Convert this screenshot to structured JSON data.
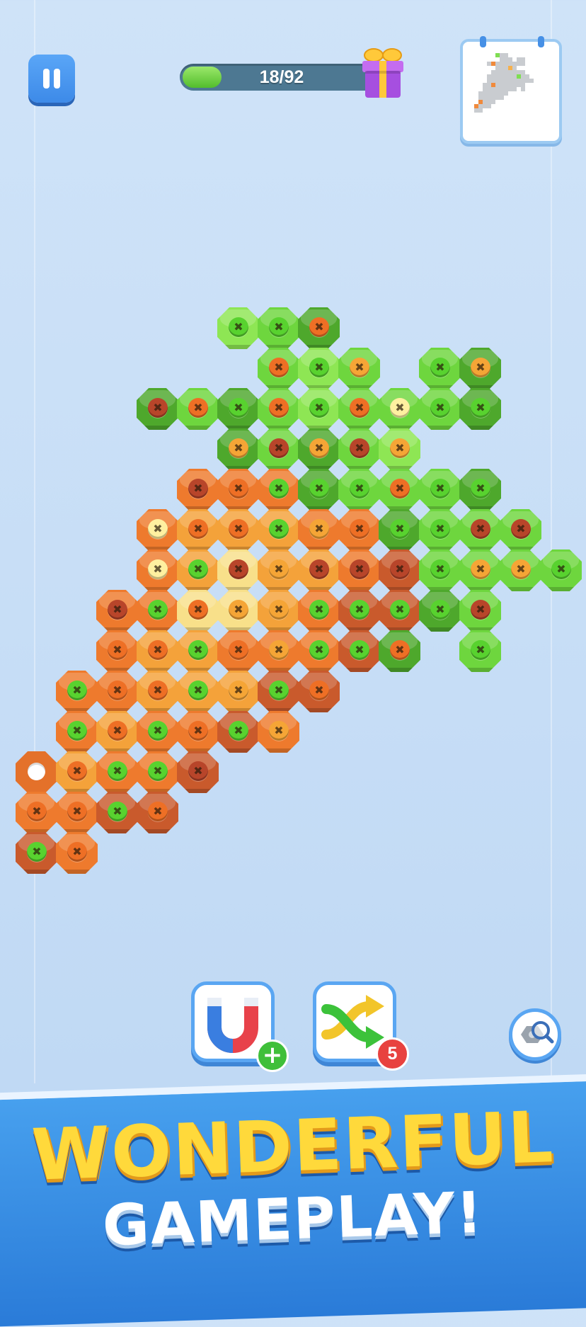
{
  "hud": {
    "progress_text": "18/92",
    "progress_fraction": 0.196,
    "pause_icon": "pause-icon",
    "reward_icon": "gift-box-icon",
    "preview_icon": "picture-preview-icon"
  },
  "colors": {
    "hole_palette": {
      "G": "#6ed63e",
      "L": "#8ee654",
      "D": "#4ea82c",
      "O": "#ee7a2d",
      "A": "#f4a23a",
      "R": "#c95a2c",
      "Y": "#f8e08a"
    },
    "screw_palette": {
      "g": "#58d22f",
      "o": "#ee6f25",
      "a": "#f5a536",
      "r": "#b8452a",
      "y": "#fff0a0"
    }
  },
  "board": {
    "cols": [
      0,
      1,
      2,
      3,
      4,
      5,
      6,
      7,
      8,
      9,
      10,
      11,
      12,
      13
    ],
    "rows": [
      [
        "",
        "",
        "",
        "",
        "",
        "L",
        "G",
        "D",
        "",
        "",
        "",
        "",
        "",
        ""
      ],
      [
        "",
        "",
        "",
        "",
        "",
        "",
        "G",
        "L",
        "G",
        "",
        "G",
        "D",
        "",
        ""
      ],
      [
        "",
        "",
        "",
        "D",
        "G",
        "D",
        "G",
        "L",
        "G",
        "G",
        "G",
        "D",
        "",
        ""
      ],
      [
        "",
        "",
        "",
        "",
        "",
        "D",
        "G",
        "D",
        "G",
        "L",
        "",
        "",
        "",
        ""
      ],
      [
        "",
        "",
        "",
        "",
        "O",
        "O",
        "O",
        "D",
        "G",
        "G",
        "G",
        "D",
        "",
        ""
      ],
      [
        "",
        "",
        "",
        "O",
        "A",
        "A",
        "A",
        "O",
        "O",
        "D",
        "G",
        "G",
        "G",
        ""
      ],
      [
        "",
        "",
        "",
        "O",
        "A",
        "Y",
        "A",
        "A",
        "O",
        "R",
        "G",
        "G",
        "G",
        "G"
      ],
      [
        "",
        "",
        "O",
        "O",
        "Y",
        "Y",
        "A",
        "O",
        "R",
        "R",
        "D",
        "G",
        "",
        ""
      ],
      [
        "",
        "",
        "O",
        "A",
        "A",
        "O",
        "O",
        "O",
        "R",
        "D",
        "",
        "G",
        "",
        ""
      ],
      [
        "",
        "O",
        "O",
        "A",
        "A",
        "A",
        "R",
        "R",
        "",
        "",
        "",
        "",
        "",
        ""
      ],
      [
        "",
        "O",
        "A",
        "O",
        "O",
        "R",
        "O",
        "",
        "",
        "",
        "",
        "",
        "",
        ""
      ],
      [
        "E",
        "A",
        "O",
        "O",
        "R",
        "",
        "",
        "",
        "",
        "",
        "",
        "",
        "",
        ""
      ],
      [
        "O",
        "O",
        "R",
        "R",
        "",
        "",
        "",
        "",
        "",
        "",
        "",
        "",
        "",
        ""
      ],
      [
        "R",
        "O",
        "",
        "",
        "",
        "",
        "",
        "",
        "",
        "",
        "",
        "",
        "",
        ""
      ]
    ],
    "screws": [
      [
        "",
        "",
        "",
        "",
        "",
        "g",
        "g",
        "o",
        "",
        "",
        "",
        "",
        "",
        ""
      ],
      [
        "",
        "",
        "",
        "",
        "",
        "",
        "o",
        "g",
        "a",
        "",
        "g",
        "a",
        "",
        ""
      ],
      [
        "",
        "",
        "",
        "r",
        "o",
        "g",
        "o",
        "g",
        "o",
        "y",
        "g",
        "g",
        "",
        ""
      ],
      [
        "",
        "",
        "",
        "",
        "",
        "a",
        "r",
        "a",
        "r",
        "a",
        "",
        "",
        "",
        ""
      ],
      [
        "",
        "",
        "",
        "",
        "r",
        "o",
        "g",
        "g",
        "g",
        "o",
        "g",
        "g",
        "",
        ""
      ],
      [
        "",
        "",
        "",
        "y",
        "o",
        "o",
        "g",
        "a",
        "o",
        "g",
        "g",
        "r",
        "r",
        ""
      ],
      [
        "",
        "",
        "",
        "y",
        "g",
        "r",
        "a",
        "r",
        "r",
        "r",
        "g",
        "a",
        "a",
        "g"
      ],
      [
        "",
        "",
        "r",
        "g",
        "o",
        "a",
        "a",
        "g",
        "g",
        "g",
        "g",
        "r",
        "",
        ""
      ],
      [
        "",
        "",
        "o",
        "o",
        "g",
        "o",
        "a",
        "g",
        "g",
        "o",
        "",
        "g",
        "",
        ""
      ],
      [
        "",
        "g",
        "o",
        "o",
        "g",
        "a",
        "g",
        "o",
        "",
        "",
        "",
        "",
        "",
        ""
      ],
      [
        "",
        "g",
        "o",
        "g",
        "o",
        "g",
        "a",
        "",
        "",
        "",
        "",
        "",
        "",
        ""
      ],
      [
        "",
        "o",
        "g",
        "g",
        "r",
        "",
        "",
        "",
        "",
        "",
        "",
        "",
        "",
        ""
      ],
      [
        "o",
        "o",
        "g",
        "o",
        "",
        "",
        "",
        "",
        "",
        "",
        "",
        "",
        "",
        ""
      ],
      [
        "g",
        "o",
        "",
        "",
        "",
        "",
        "",
        "",
        "",
        "",
        "",
        "",
        "",
        ""
      ]
    ]
  },
  "tools": {
    "magnet_icon": "magnet-icon",
    "magnet_badge": "+",
    "shuffle_icon": "shuffle-icon",
    "shuffle_count": "5",
    "search_icon": "magnifier-bolt-icon"
  },
  "banner": {
    "line1": "WONDERFUL",
    "line2": "GAMEPLAY!"
  }
}
